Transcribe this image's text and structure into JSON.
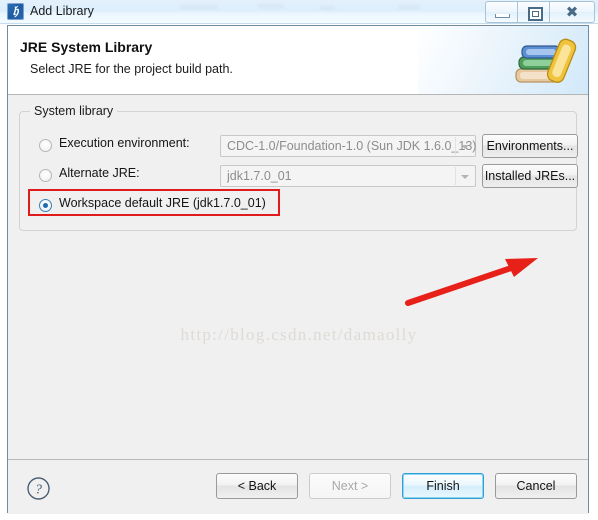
{
  "window": {
    "title": "Add Library",
    "app_icon": "java-library-icon",
    "controls": {
      "minimize": "minimize-icon",
      "maximize": "restore-icon",
      "close": "close-icon"
    }
  },
  "header": {
    "title": "JRE System Library",
    "subtitle": "Select JRE for the project build path.",
    "icon": "books-stack-icon"
  },
  "content": {
    "group_title": "System library",
    "rows": [
      {
        "radio_label": "Execution environment:",
        "selected": false,
        "combo_value": "CDC-1.0/Foundation-1.0 (Sun JDK 1.6.0_13)",
        "button_label": "Environments..."
      },
      {
        "radio_label": "Alternate JRE:",
        "selected": false,
        "combo_value": "jdk1.7.0_01",
        "button_label": "Installed JREs..."
      },
      {
        "radio_label": "Workspace default JRE (jdk1.7.0_01)",
        "selected": true,
        "combo_value": "",
        "button_label": ""
      }
    ],
    "watermark": "http://blog.csdn.net/damaolly"
  },
  "annotations": {
    "highlight_box_target": "workspace-default-jre-radio",
    "arrow_target": "installed-jres-button",
    "color": "#e01b1b"
  },
  "footer": {
    "help_label": "?",
    "buttons": [
      {
        "label": "< Back",
        "state": "enabled"
      },
      {
        "label": "Next >",
        "state": "disabled"
      },
      {
        "label": "Finish",
        "state": "default"
      },
      {
        "label": "Cancel",
        "state": "enabled"
      }
    ]
  },
  "colors": {
    "titlebar": "#dceefc",
    "dialog_bg": "#f0f0f0",
    "header_bg": "#ffffff",
    "accent": "#2f9fd8",
    "annotation_red": "#e01b1b"
  }
}
